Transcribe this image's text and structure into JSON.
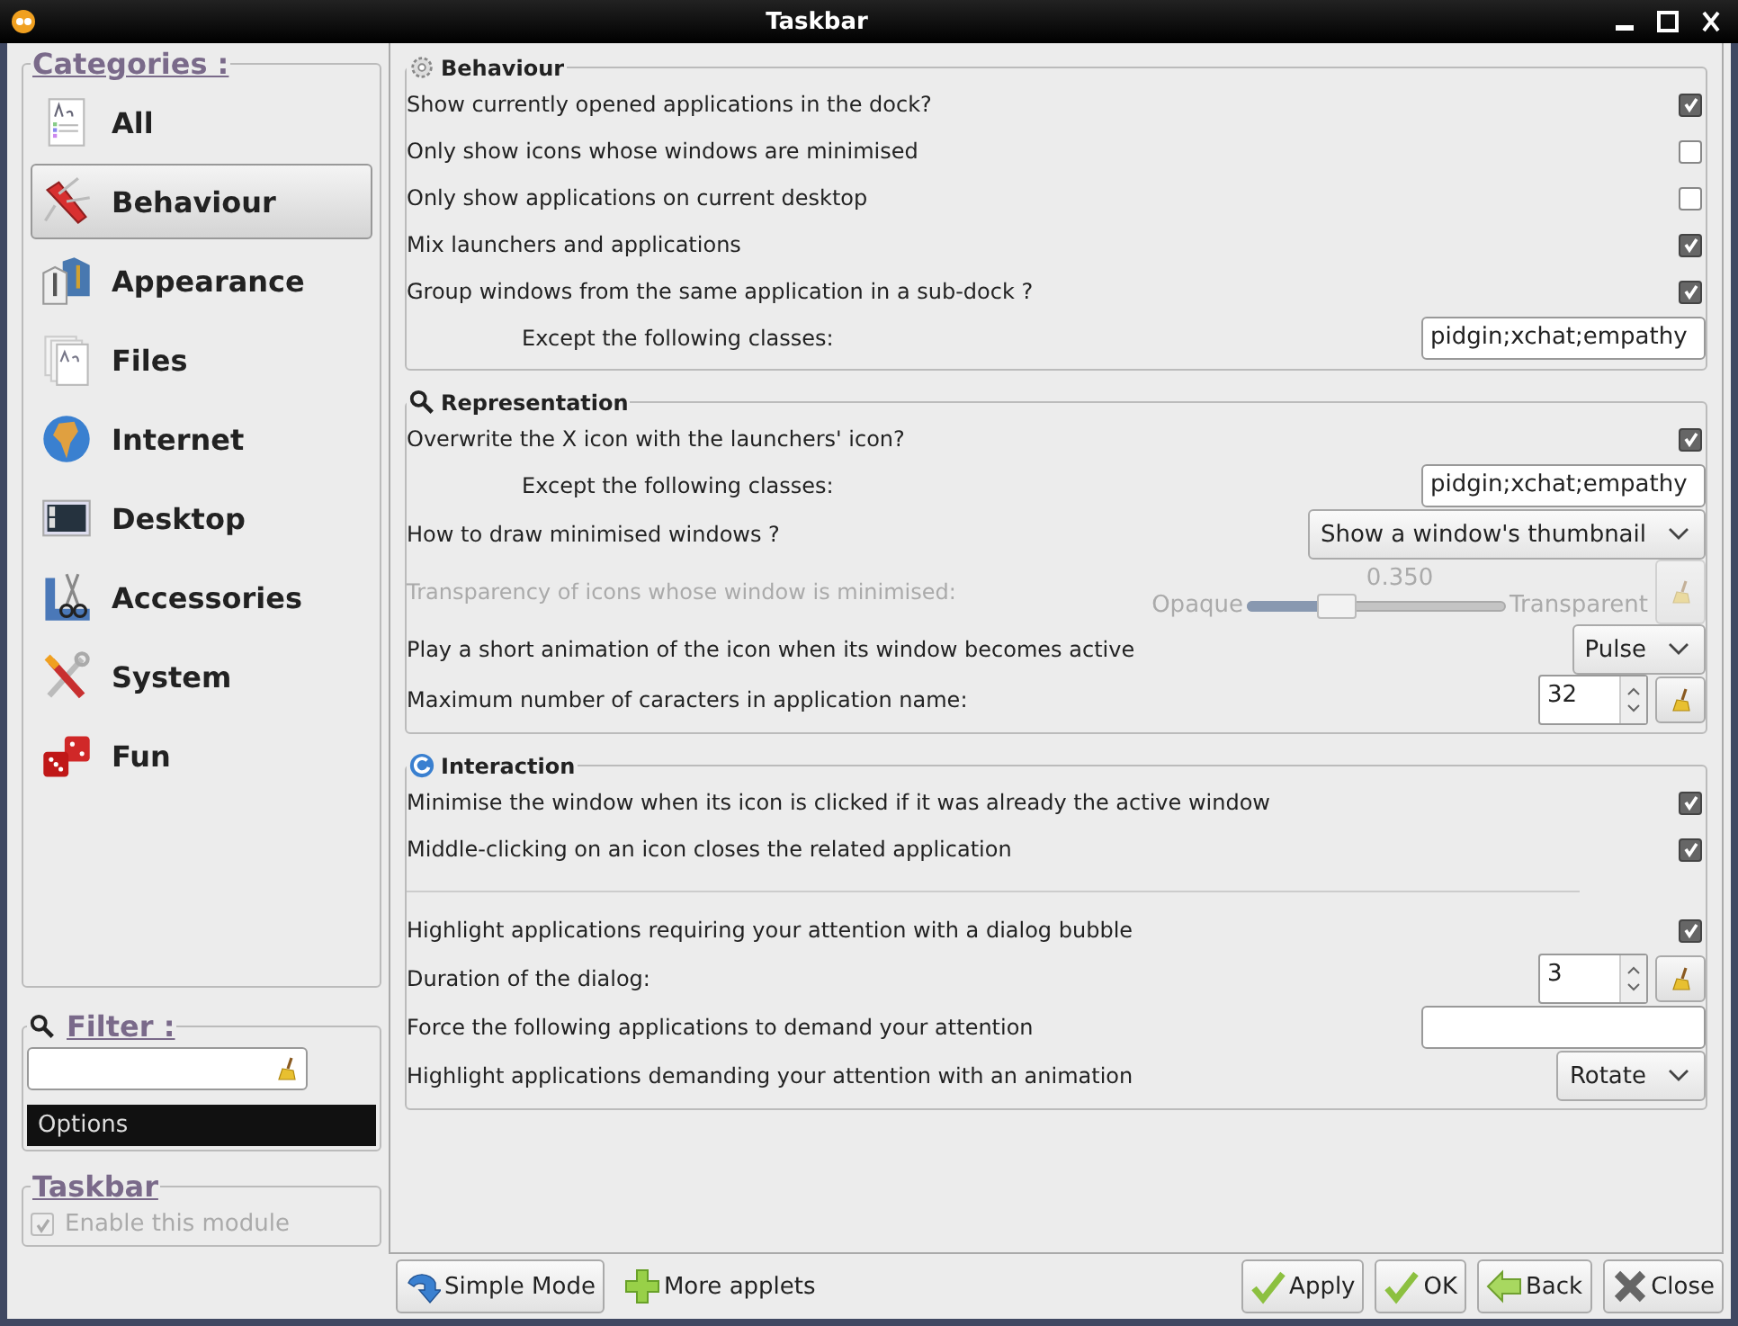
{
  "window": {
    "title": "Taskbar"
  },
  "categories": {
    "title": "Categories :",
    "items": [
      {
        "label": "All",
        "selected": false
      },
      {
        "label": "Behaviour",
        "selected": true
      },
      {
        "label": "Appearance",
        "selected": false
      },
      {
        "label": "Files",
        "selected": false
      },
      {
        "label": "Internet",
        "selected": false
      },
      {
        "label": "Desktop",
        "selected": false
      },
      {
        "label": "Accessories",
        "selected": false
      },
      {
        "label": "System",
        "selected": false
      },
      {
        "label": "Fun",
        "selected": false
      }
    ]
  },
  "filter": {
    "title": "Filter :",
    "options_label": "Options"
  },
  "module": {
    "title": "Taskbar",
    "label": "Enable this module",
    "checked": true,
    "disabled": true
  },
  "sections": [
    {
      "title": "Behaviour",
      "rows": [
        {
          "kind": "check",
          "label": "Show currently opened applications in the dock?",
          "checked": true
        },
        {
          "kind": "check",
          "label": "Only show icons whose windows are minimised",
          "checked": false
        },
        {
          "kind": "check",
          "label": "Only show applications on current desktop",
          "checked": false
        },
        {
          "kind": "check",
          "label": "Mix launchers and applications",
          "checked": true
        },
        {
          "kind": "check",
          "label": "Group windows from the same application in a sub-dock ?",
          "checked": true
        },
        {
          "kind": "subentry",
          "label": "Except the following classes:",
          "value": "pidgin;xchat;empathy"
        }
      ]
    },
    {
      "title": "Representation",
      "rows": [
        {
          "kind": "check",
          "label": "Overwrite the X icon with the launchers' icon?",
          "checked": true
        },
        {
          "kind": "subentry",
          "label": "Except the following classes:",
          "value": "pidgin;xchat;empathy"
        },
        {
          "kind": "combo",
          "label": "How to draw minimised windows ?",
          "value": "Show a window's thumbnail"
        },
        {
          "kind": "slider",
          "label": "Transparency of icons whose window is minimised:",
          "disabled": true,
          "reading": "0.350",
          "min_label": "Opaque",
          "max_label": "Transparent",
          "level": 0.35
        },
        {
          "kind": "combo",
          "label": "Play a short animation of the icon when its window becomes active",
          "value": "Pulse"
        },
        {
          "kind": "spin",
          "label": "Maximum number of caracters in application name:",
          "value": "32"
        }
      ]
    },
    {
      "title": "Interaction",
      "rows": [
        {
          "kind": "check",
          "label": "Minimise the window when its icon is clicked if it was already the active window",
          "checked": true
        },
        {
          "kind": "check",
          "label": "Middle-clicking on an icon closes the related application",
          "checked": true
        },
        {
          "kind": "separator"
        },
        {
          "kind": "check",
          "label": "Highlight applications requiring your attention with a dialog bubble",
          "checked": true
        },
        {
          "kind": "spin",
          "label": "Duration of the dialog:",
          "value": "3"
        },
        {
          "kind": "entry",
          "label": "Force the following applications to demand your attention"
        },
        {
          "kind": "combo",
          "label": "Highlight applications demanding your attention with an animation",
          "value": "Rotate"
        }
      ]
    }
  ],
  "bottom_left": [
    {
      "label": "Simple Mode",
      "framed": true
    },
    {
      "label": "More applets",
      "framed": false
    }
  ],
  "bottom_right": [
    {
      "label": "Apply"
    },
    {
      "label": "OK"
    },
    {
      "label": "Back"
    },
    {
      "label": "Close"
    }
  ]
}
